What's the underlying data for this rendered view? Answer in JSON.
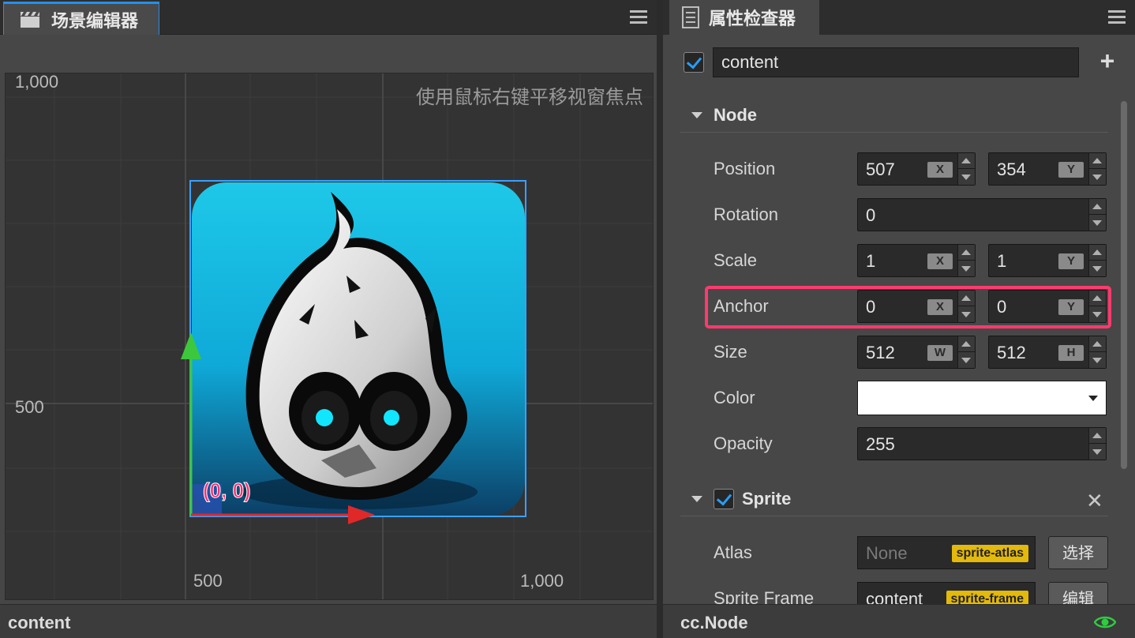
{
  "scene_editor": {
    "tab_title": "场景编辑器",
    "hint": "使用鼠标右键平移视窗焦点",
    "y_labels": [
      "1,000",
      "500"
    ],
    "x_labels": [
      "500",
      "1,000"
    ],
    "origin_label": "(0, 0)",
    "status": "content"
  },
  "inspector": {
    "tab_title": "属性检查器",
    "node_enabled": true,
    "node_name": "content",
    "node_section": {
      "title": "Node",
      "position": {
        "label": "Position",
        "x": "507",
        "y": "354",
        "x_axis": "X",
        "y_axis": "Y"
      },
      "rotation": {
        "label": "Rotation",
        "value": "0"
      },
      "scale": {
        "label": "Scale",
        "x": "1",
        "y": "1",
        "x_axis": "X",
        "y_axis": "Y"
      },
      "anchor": {
        "label": "Anchor",
        "x": "0",
        "y": "0",
        "x_axis": "X",
        "y_axis": "Y"
      },
      "size": {
        "label": "Size",
        "w": "512",
        "h": "512",
        "w_axis": "W",
        "h_axis": "H"
      },
      "color": {
        "label": "Color",
        "value": "#ffffff"
      },
      "opacity": {
        "label": "Opacity",
        "value": "255"
      }
    },
    "sprite_section": {
      "title": "Sprite",
      "enabled": true,
      "atlas": {
        "label": "Atlas",
        "value": "None",
        "badge": "sprite-atlas",
        "button": "选择"
      },
      "sprite_frame": {
        "label": "Sprite Frame",
        "value": "content",
        "badge": "sprite-frame",
        "button": "编辑"
      }
    },
    "status": "cc.Node"
  },
  "colors": {
    "accent": "#1e90ff",
    "highlight": "#ff3a6e",
    "badge": "#e3b90b",
    "eye": "#2ecc40"
  }
}
